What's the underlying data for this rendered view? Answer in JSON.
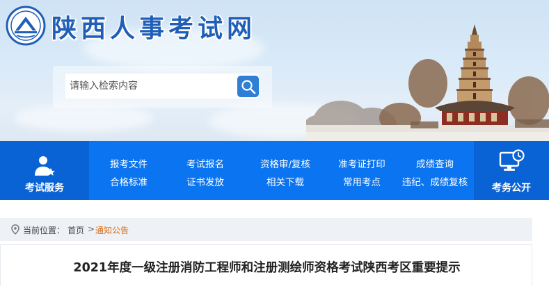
{
  "site": {
    "title": "陕西人事考试网",
    "logo_icon": "emblem-logo-icon"
  },
  "search": {
    "placeholder": "请输入检索内容",
    "value": "",
    "button_icon": "search-icon"
  },
  "nav": {
    "left": {
      "label": "考试服务",
      "icon": "service-person-icon"
    },
    "columns": [
      {
        "top": "报考文件",
        "bottom": "合格标准"
      },
      {
        "top": "考试报名",
        "bottom": "证书发放"
      },
      {
        "top": "资格审/复核",
        "bottom": "相关下载"
      },
      {
        "top": "准考证打印",
        "bottom": "常用考点"
      },
      {
        "top": "成绩查询",
        "bottom": "违纪、成绩复核"
      }
    ],
    "right": {
      "label": "考务公开",
      "icon": "monitor-clock-icon"
    }
  },
  "breadcrumb": {
    "label": "当前位置：",
    "home": "首页",
    "separator": ">",
    "current": "通知公告",
    "icon": "location-pin-icon"
  },
  "article": {
    "title": "2021年度一级注册消防工程师和注册测绘师资格考试陕西考区重要提示"
  },
  "colors": {
    "nav_blue": "#0b74f0",
    "nav_side_blue": "#0a63d4",
    "title_blue": "#1f5fb8",
    "crumb_current": "#d86a14"
  }
}
